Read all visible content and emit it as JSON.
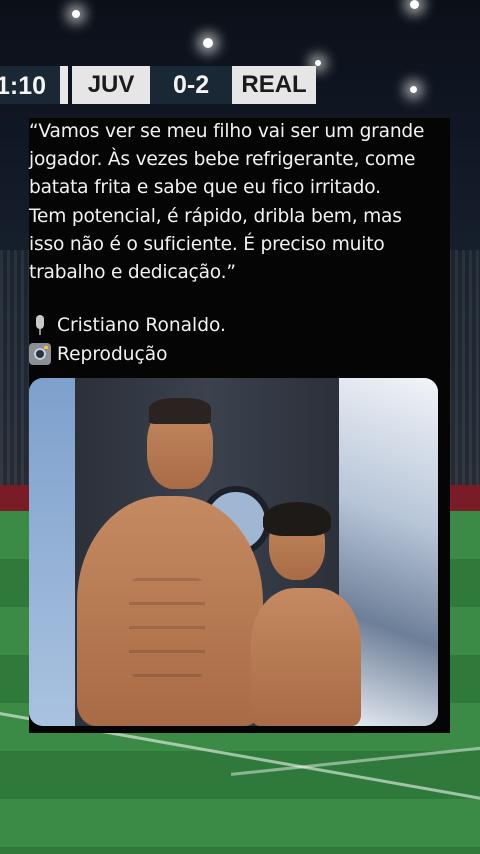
{
  "scoreboard": {
    "time": "1:10",
    "home_team": "JUV",
    "score": "0-2",
    "away_team": "REAL"
  },
  "post": {
    "quote": "“Vamos ver se meu filho vai ser um grande\njogador. Às vezes bebe refrigerante, come\nbatata frita e sabe que eu fico irritado.\nTem potencial, é rápido, dribla bem, mas\nisso não é o suficiente. É preciso muito\ntrabalho e dedicação.”",
    "author_icon": "microphone-icon",
    "author": "Cristiano Ronaldo.",
    "photo_credit_icon": "camera-icon",
    "photo_credit": "Reprodução"
  },
  "colors": {
    "card_background": "#050505",
    "text": "#f2f2f2",
    "scoreboard_dark": "#1a2836",
    "scoreboard_light": "#e6e6e6",
    "pitch": "#2f7a3b"
  }
}
